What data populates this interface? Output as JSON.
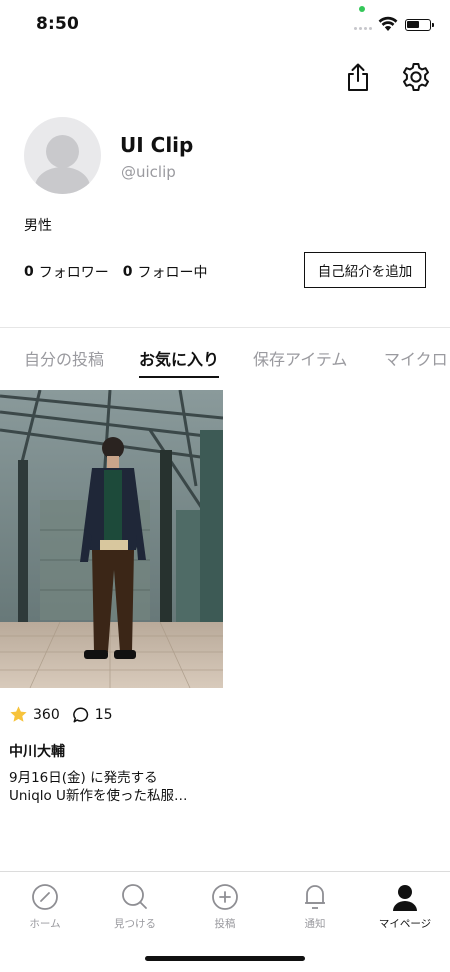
{
  "status_bar": {
    "time": "8:50"
  },
  "profile": {
    "display_name": "UI Clip",
    "handle": "@uiclip",
    "gender": "男性",
    "followers_count": "0",
    "followers_label": "フォロワー",
    "following_count": "0",
    "following_label": "フォロー中",
    "add_bio_label": "自己紹介を追加"
  },
  "tabs": [
    {
      "label": "自分の投稿",
      "active": false
    },
    {
      "label": "お気に入り",
      "active": true
    },
    {
      "label": "保存アイテム",
      "active": false
    },
    {
      "label": "マイクロ",
      "active": false
    }
  ],
  "post": {
    "likes": "360",
    "comments": "15",
    "author": "中川大輔",
    "caption_line1": "9月16日(金) に発売する",
    "caption_line2": "Uniqlo U新作を使った私服…"
  },
  "bottom_nav": [
    {
      "label": "ホーム",
      "icon": "compass-icon",
      "active": false
    },
    {
      "label": "見つける",
      "icon": "search-icon",
      "active": false
    },
    {
      "label": "投稿",
      "icon": "plus-circle-icon",
      "active": false
    },
    {
      "label": "通知",
      "icon": "bell-icon",
      "active": false
    },
    {
      "label": "マイページ",
      "icon": "person-icon",
      "active": true
    }
  ],
  "colors": {
    "text": "#111111",
    "muted": "#9a9a9f",
    "star": "#f7c33b",
    "divider": "#e6e6e6",
    "status_dot": "#34c759"
  }
}
